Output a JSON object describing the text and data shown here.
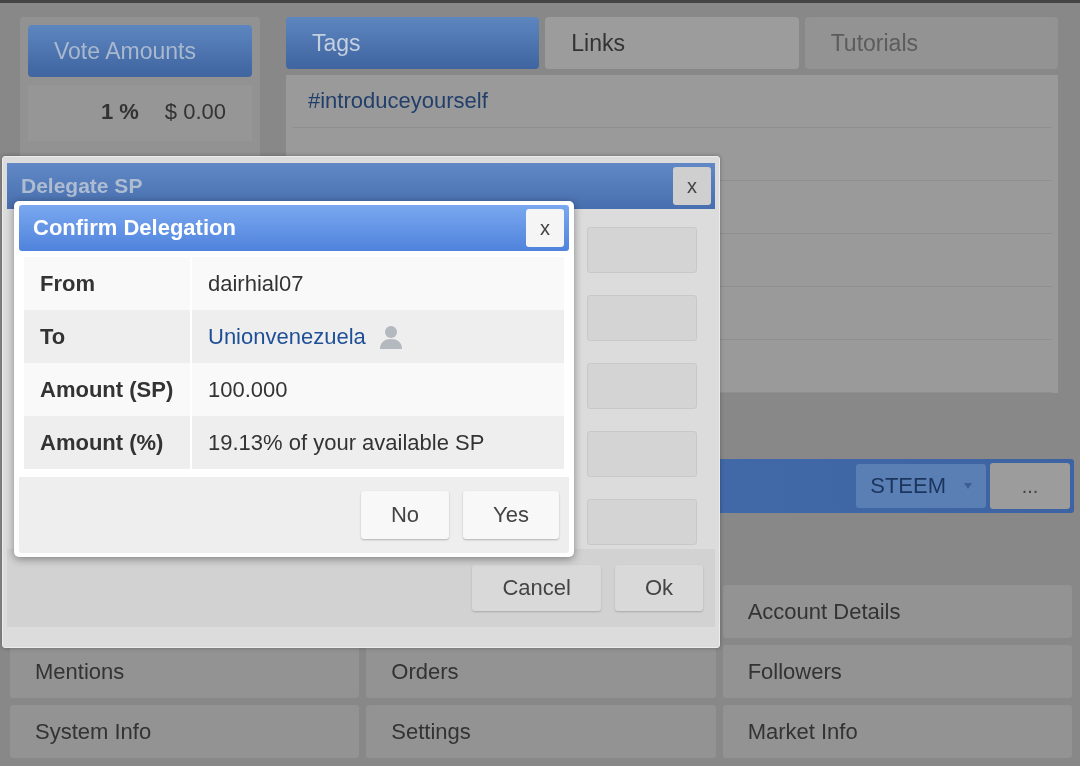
{
  "vote_amounts": {
    "title": "Vote Amounts",
    "rows": [
      {
        "percent": "1 %",
        "value": "$ 0.00"
      }
    ]
  },
  "tabs": [
    {
      "label": "Tags",
      "selected": true,
      "disabled": false
    },
    {
      "label": "Links",
      "selected": false,
      "disabled": false
    },
    {
      "label": "Tutorials",
      "selected": false,
      "disabled": true
    }
  ],
  "tag_list": [
    "#introduceyourself"
  ],
  "wallet_bar": {
    "currency": "STEEM",
    "more_button": "..."
  },
  "menu_columns": [
    [
      "Mentions",
      "System Info"
    ],
    [
      "Orders",
      "Settings"
    ],
    [
      "Account Details",
      "Followers",
      "Market Info"
    ]
  ],
  "delegate_dialog": {
    "title": "Delegate SP",
    "close": "x",
    "buttons": [
      "Cancel",
      "Ok"
    ]
  },
  "confirm_dialog": {
    "title": "Confirm Delegation",
    "close": "x",
    "rows": [
      {
        "label": "From",
        "value": "dairhial07",
        "kind": "text"
      },
      {
        "label": "To",
        "value": "Unionvenezuela",
        "kind": "account"
      },
      {
        "label": "Amount (SP)",
        "value": "100.000",
        "kind": "text"
      },
      {
        "label": "Amount (%)",
        "value": "19.13% of your available SP",
        "kind": "text"
      }
    ],
    "buttons": [
      "No",
      "Yes"
    ]
  }
}
